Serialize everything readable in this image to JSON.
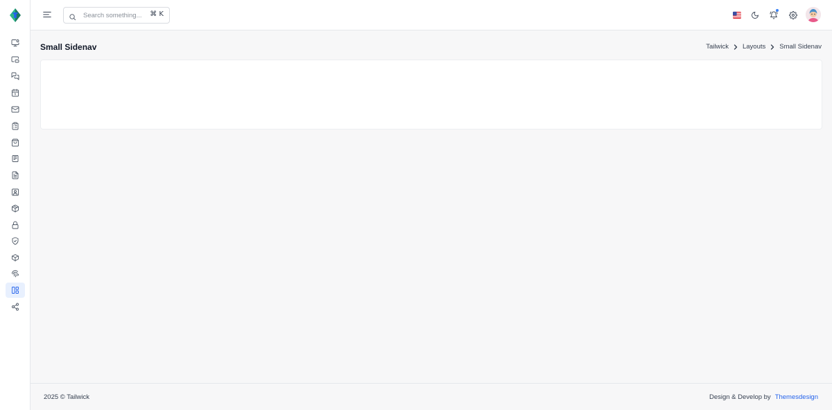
{
  "search": {
    "placeholder": "Search something...",
    "shortcut": "⌘ K"
  },
  "page": {
    "title": "Small Sidenav"
  },
  "breadcrumb": [
    "Tailwick",
    "Layouts",
    "Small Sidenav"
  ],
  "footer": {
    "copyright": "2025 © Tailwick",
    "credit_prefix": "Design & Develop by",
    "credit_link": "Themesdesign"
  },
  "sidebar": {
    "items": [
      {
        "icon": "monitor-dot-icon"
      },
      {
        "icon": "picture-in-picture-icon"
      },
      {
        "icon": "messages-square-icon"
      },
      {
        "icon": "calendar-icon"
      },
      {
        "icon": "mail-icon"
      },
      {
        "icon": "clipboard-list-icon"
      },
      {
        "icon": "shopping-bag-icon"
      },
      {
        "icon": "newspaper-icon"
      },
      {
        "icon": "file-text-icon"
      },
      {
        "icon": "contact-icon"
      },
      {
        "icon": "boxes-icon"
      },
      {
        "icon": "lock-icon"
      },
      {
        "icon": "shield-check-icon"
      },
      {
        "icon": "package-icon"
      },
      {
        "icon": "fingerprint-icon"
      },
      {
        "icon": "layout-icon",
        "active": true
      },
      {
        "icon": "share-icon"
      }
    ]
  },
  "colors": {
    "accent": "#2563eb",
    "active_bg": "#e8f0fe",
    "page_bg": "#f7f7f8"
  }
}
